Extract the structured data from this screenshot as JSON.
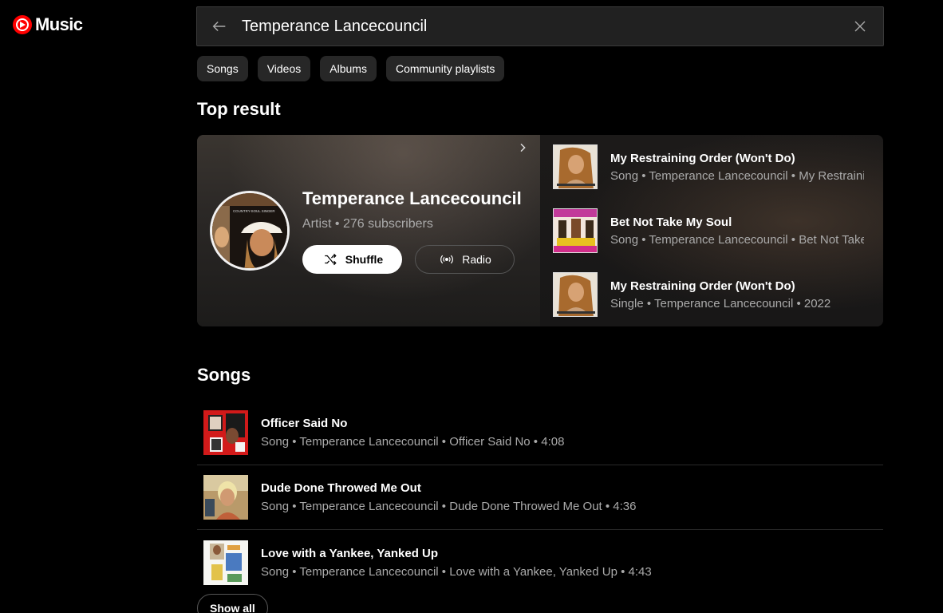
{
  "app": {
    "logo_text": "Music",
    "accent": "#ff0000"
  },
  "search": {
    "value": "Temperance Lancecouncil"
  },
  "filters": [
    "Songs",
    "Videos",
    "Albums",
    "Community playlists"
  ],
  "top_result": {
    "heading": "Top result",
    "artist": {
      "name": "Temperance Lancecouncil",
      "subtitle": "Artist • 276 subscribers",
      "avatar_text": "COUNTRY-SOUL SINGER"
    },
    "shuffle_label": "Shuffle",
    "radio_label": "Radio",
    "items": [
      {
        "title": "My Restraining Order (Won't Do)",
        "subtitle": "Song • Temperance Lancecouncil • My Restraining Order (Won't Do)"
      },
      {
        "title": "Bet Not Take My Soul",
        "subtitle": "Song • Temperance Lancecouncil • Bet Not Take My Soul"
      },
      {
        "title": "My Restraining Order (Won't Do)",
        "subtitle": "Single • Temperance Lancecouncil • 2022"
      }
    ]
  },
  "songs": {
    "heading": "Songs",
    "items": [
      {
        "title": "Officer Said No",
        "subtitle": "Song • Temperance Lancecouncil • Officer Said No • 4:08"
      },
      {
        "title": "Dude Done Throwed Me Out",
        "subtitle": "Song • Temperance Lancecouncil • Dude Done Throwed Me Out • 4:36"
      },
      {
        "title": "Love with a Yankee, Yanked Up",
        "subtitle": "Song • Temperance Lancecouncil • Love with a Yankee, Yanked Up • 4:43"
      }
    ],
    "show_all_label": "Show all"
  }
}
